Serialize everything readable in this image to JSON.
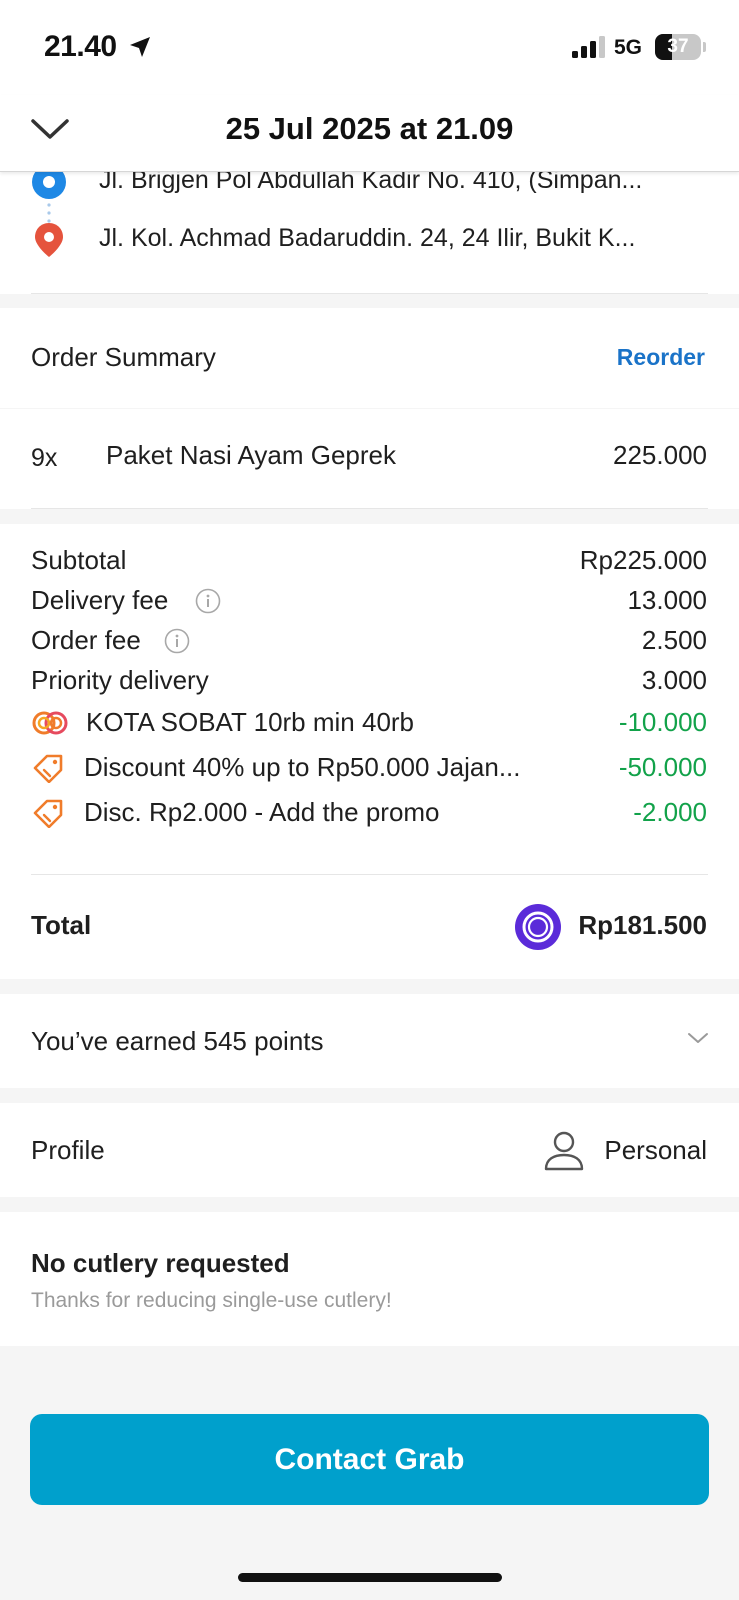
{
  "status_bar": {
    "time": "21.40",
    "network": "5G",
    "battery": "37",
    "battery_level": 0.37
  },
  "header": {
    "title": "25 Jul 2025 at 21.09"
  },
  "route": {
    "pickup": "Jl. Brigjen Pol Abdullah Kadir No. 410, (Simpan...",
    "dropoff": "Jl. Kol. Achmad Badaruddin. 24, 24 Ilir, Bukit K..."
  },
  "order_summary": {
    "title": "Order Summary",
    "reorder_label": "Reorder",
    "items": [
      {
        "qty": "9x",
        "name": "Paket Nasi Ayam Geprek",
        "price": "225.000"
      }
    ]
  },
  "breakdown": {
    "subtotal_label": "Subtotal",
    "subtotal_value": "Rp225.000",
    "delivery_fee_label": "Delivery fee",
    "delivery_fee_value": "13.000",
    "order_fee_label": "Order fee",
    "order_fee_value": "2.500",
    "priority_label": "Priority delivery",
    "priority_value": "3.000",
    "promos": [
      {
        "icon": "membership-rings-icon",
        "label": "KOTA SOBAT 10rb min 40rb",
        "value": "-10.000"
      },
      {
        "icon": "price-tag-icon",
        "label": "Discount 40% up to Rp50.000 Jajan...",
        "value": "-50.000"
      },
      {
        "icon": "price-tag-icon",
        "label": "Disc. Rp2.000 - Add the promo",
        "value": "-2.000"
      }
    ],
    "total_label": "Total",
    "total_value": "Rp181.500",
    "payment_icon": "ovo-wallet-icon"
  },
  "points": {
    "text": "You’ve earned 545 points"
  },
  "profile": {
    "label": "Profile",
    "value": "Personal"
  },
  "cutlery": {
    "title": "No cutlery requested",
    "subtitle": "Thanks for reducing single-use cutlery!"
  },
  "contact_button": {
    "label": "Contact Grab"
  },
  "colors": {
    "accent_blue": "#1a73c8",
    "button_bg": "#00a0cc",
    "discount_green": "#12a24a",
    "promo_orange": "#f07c2a",
    "pickup_pin": "#1e88e5",
    "dropoff_pin": "#e5533d",
    "payment_purple": "#5b2bd9"
  }
}
